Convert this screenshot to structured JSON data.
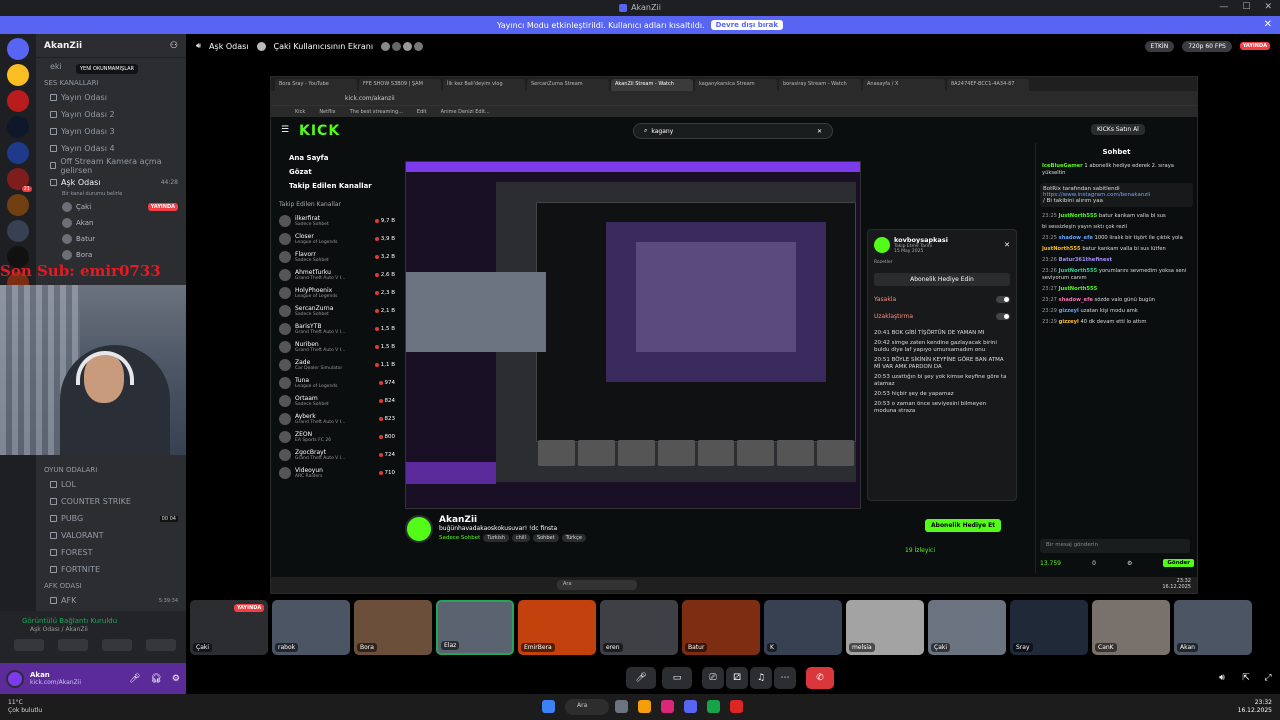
{
  "window": {
    "title": "AkanZii"
  },
  "banner": {
    "text": "Yayıncı Modu etkinleştirildi. Kullanıcı adları kısaltıldı.",
    "button": "Devre dışı bırak"
  },
  "sidebar": {
    "server_name": "AkanZii",
    "tooltip": "YENİ OKUNMAMIŞLAR",
    "partial_top": "eki",
    "category_sesler": "SES KANALLARI",
    "channels": [
      "Yayın Odası",
      "Yayın Odası 2",
      "Yayın Odası 3",
      "Yayın Odası 4",
      "Off Stream Kamera açma gelirsen"
    ],
    "active_channel": "Aşk Odası",
    "active_status": "Bir kanal durumu belirle",
    "active_time": "44:28",
    "users": [
      {
        "name": "Çaki",
        "badge": "YAYINDA"
      },
      {
        "name": "Akan"
      },
      {
        "name": "Batur"
      },
      {
        "name": "Bora"
      }
    ],
    "category_games": "OYUN ODALARI",
    "game_channels": [
      {
        "name": "LOL"
      },
      {
        "name": "COUNTER STRIKE"
      },
      {
        "name": "PUBG",
        "extra": "00  04"
      },
      {
        "name": "VALORANT"
      },
      {
        "name": "FOREST"
      },
      {
        "name": "FORTNITE"
      }
    ],
    "category_afk": "AFK ODASI",
    "afk": {
      "name": "AFK",
      "time": "5:39:34"
    }
  },
  "overlay_text": "Son Sub: emir0733",
  "voice_status": {
    "title": "Görüntülü Bağlantı Kuruldu",
    "subtitle": "Aşk Odası / AkanZii"
  },
  "user_panel": {
    "name": "Akan",
    "status": "kick.com/AkanZii"
  },
  "stage": {
    "channel": "Aşk Odası",
    "screen_label": "Çaki Kullanıcısının Ekranı",
    "live_pill": "ETKİN",
    "quality": "720p 60 FPS",
    "live_badge": "YAYINDA"
  },
  "browser": {
    "tabs": [
      "Bora Sray - YouTube",
      "FFE SHOW S3B09 | ŞAM",
      "İlk kez Bali'deyim vlog",
      "SercanZurna Stream",
      "AkanZii Stream - Watch",
      "kaganykarsica Stream",
      "borasiray Stream - Watch",
      "Anasayfa / X",
      "8A2474EF-BCC1-4A34-87"
    ],
    "url": "kick.com/akanzii",
    "bookmarks": [
      "Kick",
      "Netflix",
      "The best streaming...",
      "Edit",
      "Anime Denizi Edit..."
    ]
  },
  "kick": {
    "logo": "KICK",
    "search": "kagany",
    "buy_kicks": "KICKs Satın Al",
    "nav": [
      "Ana Sayfa",
      "Gözat",
      "Takip Edilen Kanallar"
    ],
    "following_header": "Takip Edilen Kanallar",
    "following": [
      {
        "name": "ilkerfirat",
        "cat": "Sadece Sohbet",
        "count": "9,7 B"
      },
      {
        "name": "Closer",
        "cat": "League of Legends",
        "count": "3,9 B"
      },
      {
        "name": "Flavorr",
        "cat": "Sadece Sohbet",
        "count": "3,2 B"
      },
      {
        "name": "AhmetTurku",
        "cat": "Grand Theft Auto V I...",
        "count": "2,6 B"
      },
      {
        "name": "HolyPhoenix",
        "cat": "League of Legends",
        "count": "2,3 B"
      },
      {
        "name": "SercanZurna",
        "cat": "Sadece Sohbet",
        "count": "2,1 B"
      },
      {
        "name": "BarisYTB",
        "cat": "Grand Theft Auto V I...",
        "count": "1,5 B"
      },
      {
        "name": "Nuriben",
        "cat": "Grand Theft Auto V I...",
        "count": "1,5 B"
      },
      {
        "name": "Zade",
        "cat": "Car Dealer Simulator",
        "count": "1,1 B"
      },
      {
        "name": "Tuna",
        "cat": "League of Legends",
        "count": "974"
      },
      {
        "name": "Ortaam",
        "cat": "Sadece Sohbet",
        "count": "824"
      },
      {
        "name": "Ayberk",
        "cat": "Grand Theft Auto V I...",
        "count": "823"
      },
      {
        "name": "ZEON",
        "cat": "EA Sports FC 26",
        "count": "800"
      },
      {
        "name": "ZgocBrayt",
        "cat": "Grand Theft Auto V I...",
        "count": "724"
      },
      {
        "name": "Videoyun",
        "cat": "ARC Raiders",
        "count": "710"
      }
    ],
    "popup": {
      "name": "kovboysapkasi",
      "date_label": "Takip Etme Tarihi",
      "date": "15 May 2025",
      "badges": "Rozetler",
      "gift": "Abonelik Hediye Edin",
      "ban": "Yasakla",
      "timeout": "Uzaklaştırma",
      "log": [
        "20:41 BOK GİBİ TİŞÖRTÜN DE YAMAN MI",
        "20:42 simge zaten kendine gazlayacak birini buldu diye laf yapıyo umursamadım onu",
        "20:51 BÖYLE SİKİNİN KEYFİNE GÖRE BAN ATMA Mİ VAR AMK PARDON DA",
        "20:53 uzattığın bi şey yok kimse keyfine göre ta atamaz",
        "20:53 hiçbir şey de yapamaz",
        "20:53 o zaman önce seviyesini bilmeyen moduna straza"
      ]
    },
    "channel": {
      "name": "AkanZii",
      "title": "buğünhavadakaoskokusuvar! !dc finsta",
      "category": "Sadece Sohbet",
      "tags": [
        "Turkish",
        "chill",
        "Sohbet",
        "Türkçe"
      ],
      "follow": "Abonelik Hediye Et",
      "viewers": "19 İzleyici"
    },
    "chat": {
      "title": "Sohbet",
      "top_user": "IceBlueGamer",
      "top_text": "1 abonelik hediye ederek 2. sıraya yükseltin",
      "pinned_by": "BotRix tarafından sabitlendi",
      "pinned_link": "https://www.instagram.com/benakanzii",
      "pinned_text": "/ Bi takibini alırım yaa",
      "messages": [
        {
          "ts": "23:25",
          "user": "JustNorth555",
          "text": "batur kankam valla bi sus"
        },
        {
          "ts": "",
          "user": "",
          "text": "bi sessizleşin yayın sıktı çok rezil"
        },
        {
          "ts": "23:25",
          "user": "shadow_efe",
          "text": "1000 liralık bir tişört ile çıktık yola"
        },
        {
          "ts": "",
          "user": "JustNorth555",
          "text": "batur kankam valla bi sus lütfen"
        },
        {
          "ts": "23:26",
          "user": "Batur361thefinest",
          "text": ""
        },
        {
          "ts": "23:26",
          "user": "JustNorth555",
          "text": "yorumlarını sevmedim yoksa seni seviyorum canım"
        },
        {
          "ts": "23:27",
          "user": "JustNorth555",
          "text": ""
        },
        {
          "ts": "23:27",
          "user": "shadow_efe",
          "text": "sözde valo günü bugün"
        },
        {
          "ts": "23:29",
          "user": "gizzeyl",
          "text": "uzatan kişi modu amk"
        },
        {
          "ts": "23:29",
          "user": "gizzeyl",
          "text": "40 dk devam etti lo attım"
        }
      ],
      "input_placeholder": "Bir mesaj gönderin",
      "points": "13.759",
      "zero": "0",
      "send": "Gönder"
    },
    "inner_search": "Ara",
    "inner_clock": "23:32",
    "inner_date": "16.12.2025"
  },
  "participants": [
    {
      "name": "Çaki"
    },
    {
      "name": "rabok"
    },
    {
      "name": "Bora"
    },
    {
      "name": "Elaz"
    },
    {
      "name": "EmirBera"
    },
    {
      "name": "eren"
    },
    {
      "name": "Batur"
    },
    {
      "name": "K"
    },
    {
      "name": "melsia"
    },
    {
      "name": "Çaki"
    },
    {
      "name": "Sray"
    },
    {
      "name": "CanK"
    },
    {
      "name": "Akan"
    }
  ],
  "participant_badge": "YAYINDA",
  "taskbar": {
    "weather_temp": "11°C",
    "weather_text": "Çok bulutlu",
    "search": "Ara",
    "time": "23:32",
    "date": "16.12.2025"
  },
  "colors": {
    "kick_green": "#53fc18",
    "discord_blurple": "#5865f2",
    "live_red": "#f23f43",
    "user_panel": "#5c2b9a"
  }
}
